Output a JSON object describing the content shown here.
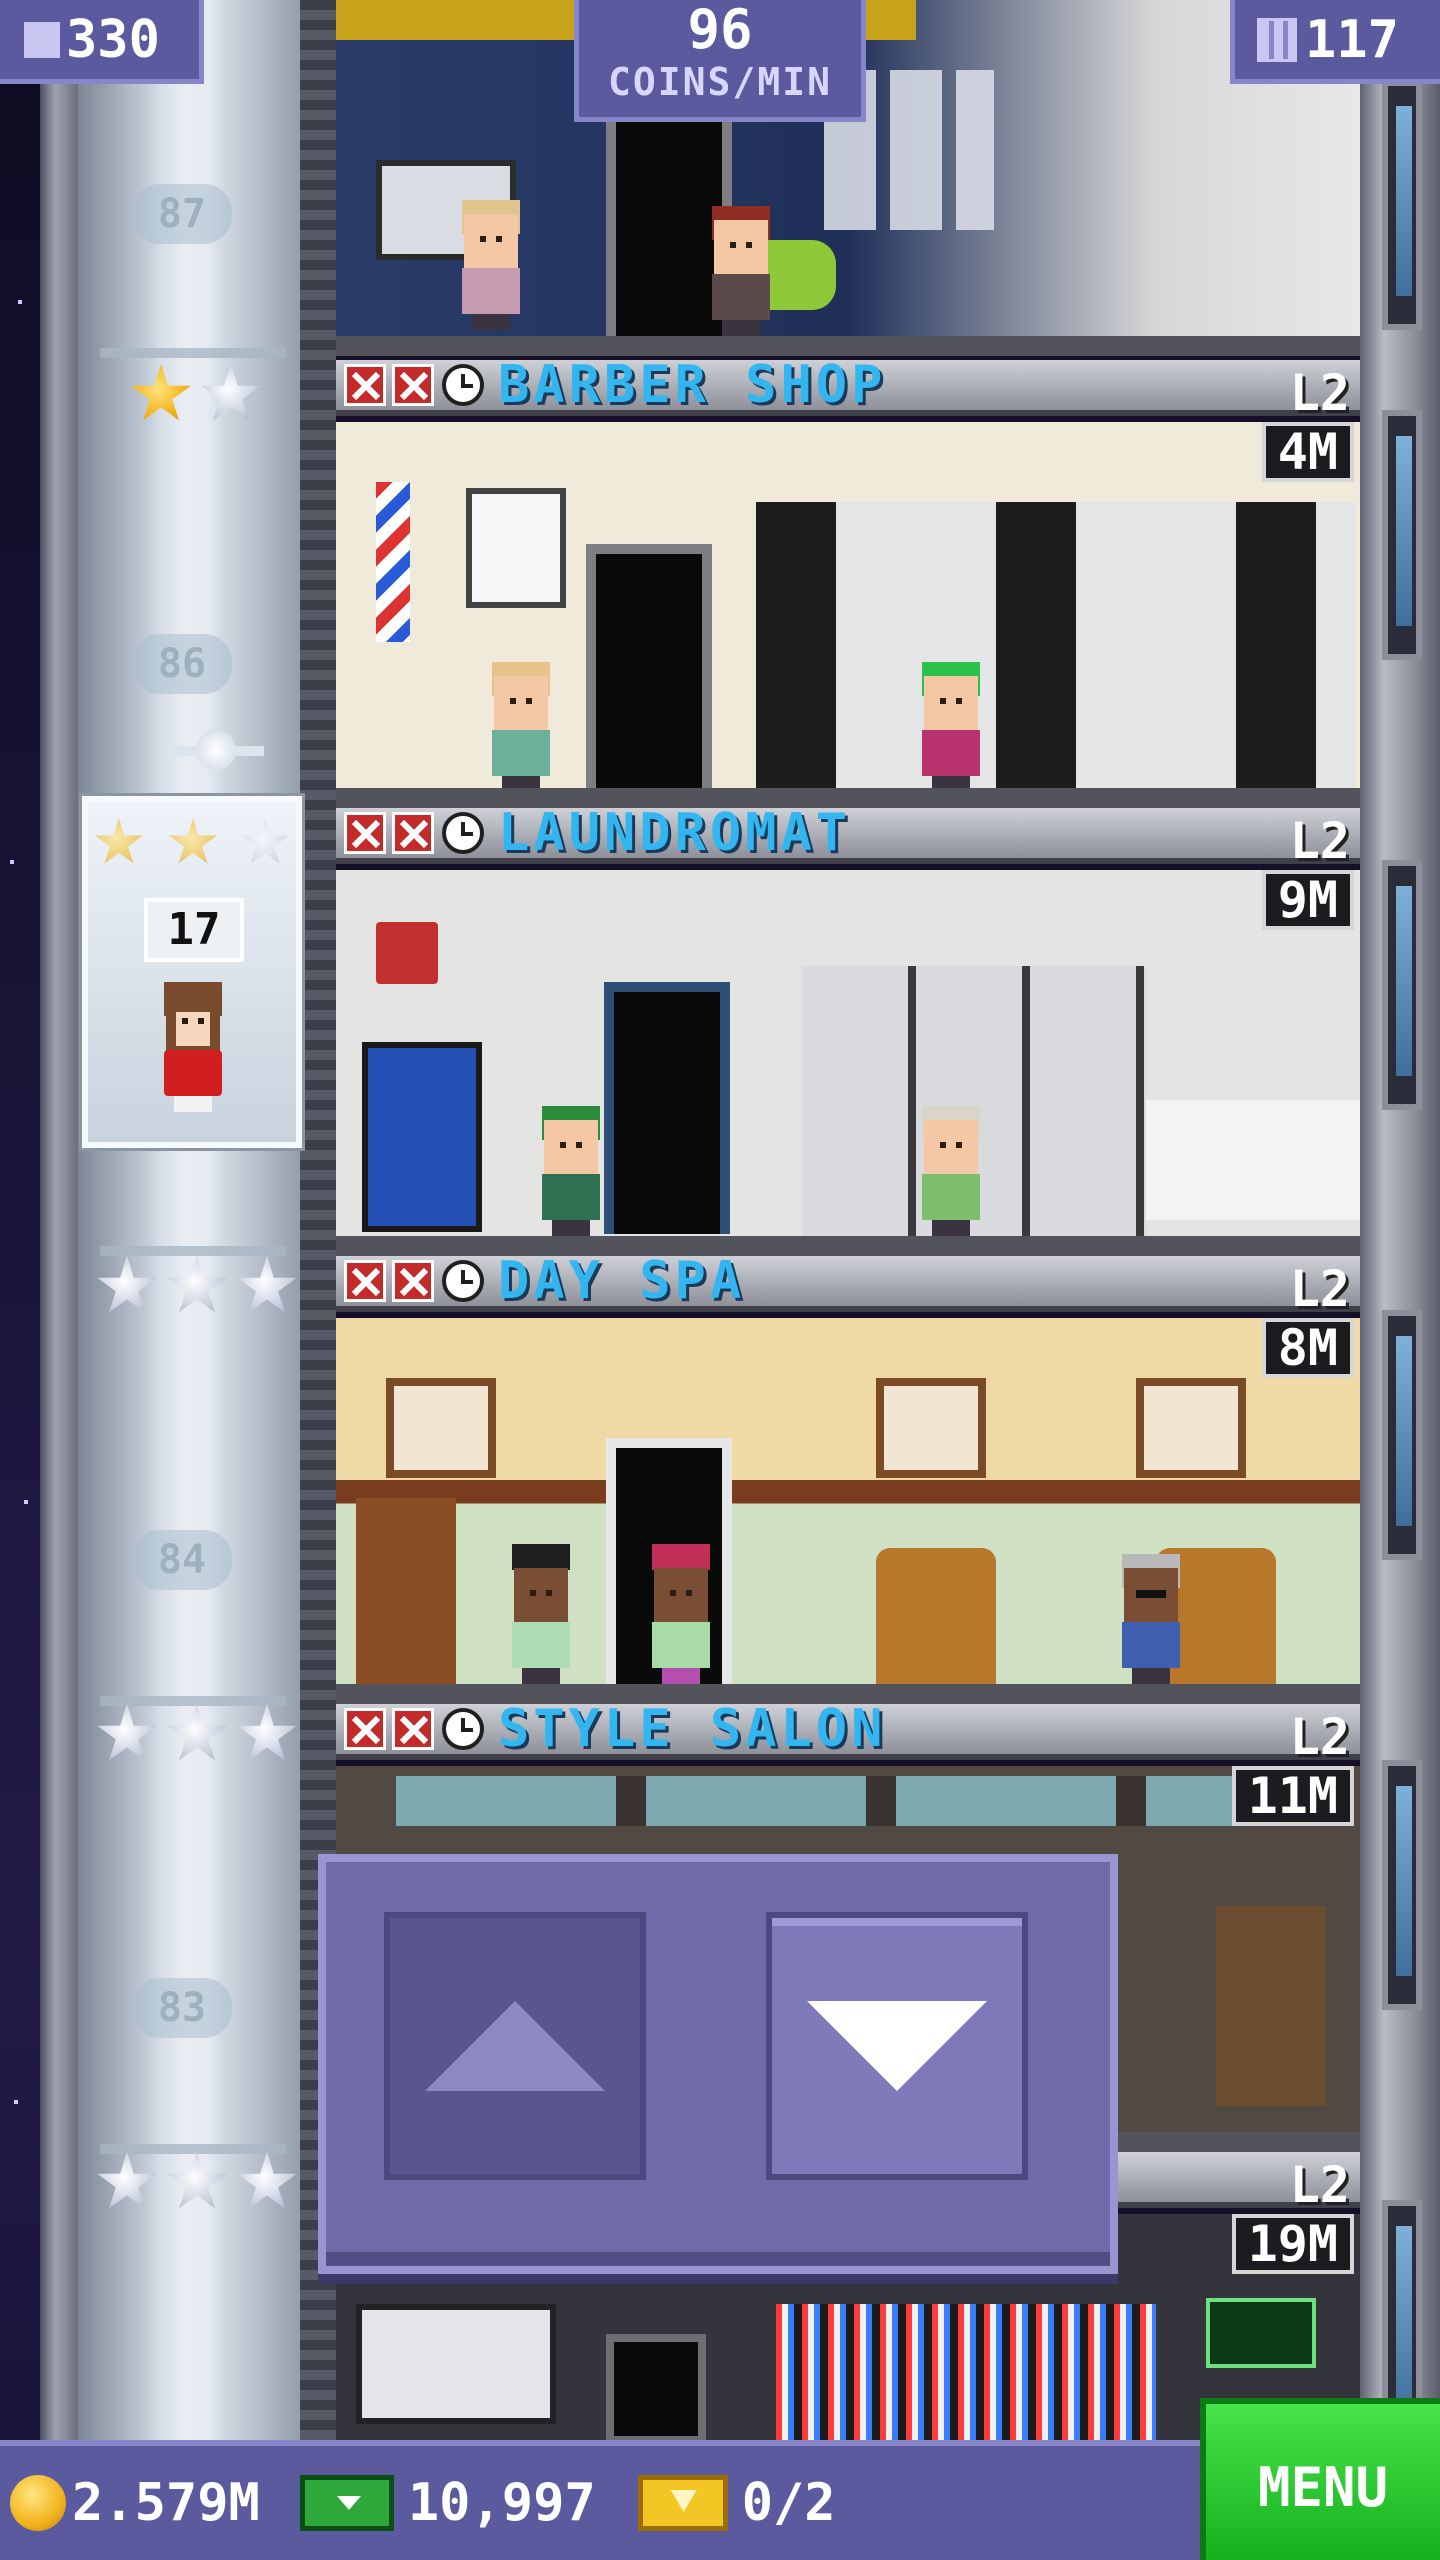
{
  "hud": {
    "population": "330",
    "coins_rate_value": "96",
    "coins_rate_label": "COINS/MIN",
    "floors_count": "117"
  },
  "shaft": {
    "floor_numbers": [
      "87",
      "86",
      "84",
      "83"
    ]
  },
  "elevator": {
    "passenger_floor": "17"
  },
  "floors": [
    {
      "name": "BARBER SHOP",
      "level": "L2",
      "time": "4M",
      "stars": "1 of 2"
    },
    {
      "name": "LAUNDROMAT",
      "level": "L2",
      "time": "9M"
    },
    {
      "name": "DAY SPA",
      "level": "L2",
      "time": "8M"
    },
    {
      "name": "STYLE SALON",
      "level": "L2",
      "time": "11M"
    },
    {
      "name": "",
      "level": "L2",
      "time": "19M"
    }
  ],
  "bottom_bar": {
    "coins": "2.579M",
    "bux": "10,997",
    "tickets": "0/2",
    "menu_label": "MENU"
  },
  "colors": {
    "hud_bg": "#5b5a9e",
    "floor_name": "#33b6f0",
    "menu_green": "#2ec933",
    "lock_red": "#c52a2a"
  }
}
